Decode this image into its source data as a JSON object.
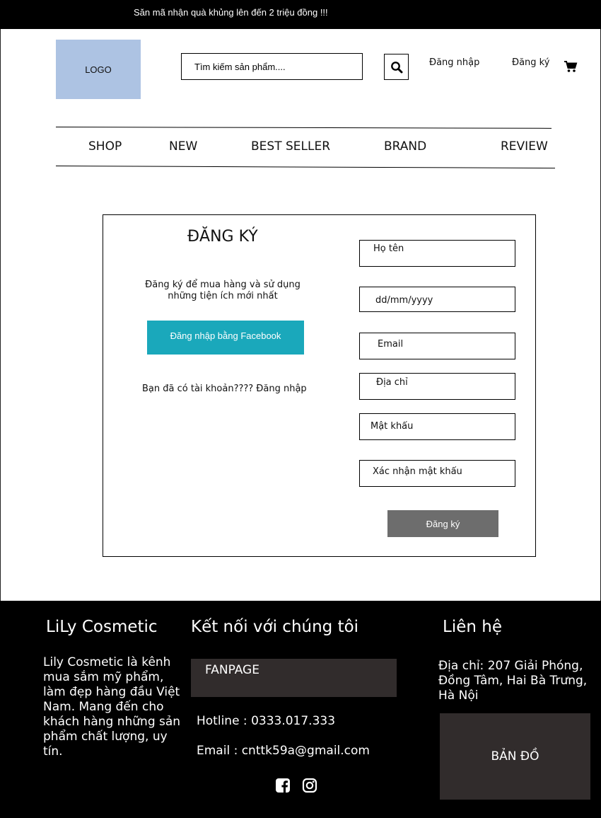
{
  "promo": {
    "text": "Săn mã nhận quà khủng lên đến 2 triệu đồng !!!"
  },
  "header": {
    "logo": "LOGO",
    "search_placeholder": "Tìm kiếm sản phẩm....",
    "login": "Đăng nhập",
    "register": "Đăng ký"
  },
  "nav": {
    "items": [
      "SHOP",
      "NEW",
      "BEST SELLER",
      "BRAND",
      "REVIEW"
    ]
  },
  "register": {
    "title": "ĐĂNG KÝ",
    "description": "Đăng ký để mua hàng và sử dụng những tiện ích mới nhất",
    "facebook_button": "Đăng nhập bằng Facebook",
    "have_account": "Bạn đã có tài khoản???? Đăng nhập",
    "fields": {
      "fullname": "Họ tên",
      "birthday": "dd/mm/yyyy",
      "email": "Email",
      "address": "Địa chỉ",
      "password": "Mật khẩu",
      "confirm_password": "Xác nhận mật khẩu"
    },
    "submit": "Đăng ký"
  },
  "footer": {
    "brand_title": "LiLy Cosmetic",
    "brand_desc": "Lily Cosmetic là kênh mua sắm mỹ phẩm, làm đẹp hàng đầu Việt Nam. Mang đến cho khách hàng những sản phẩm chất lượng, uy tín.",
    "connect_title": "Kết nối với chúng tôi",
    "fanpage": "FANPAGE",
    "hotline": "Hotline : 0333.017.333",
    "email": "Email : cnttk59a@gmail.com",
    "contact_title": "Liên hệ",
    "address": "Địa chỉ: 207 Giải Phóng, Đồng Tâm, Hai Bà Trưng, Hà Nội",
    "map": "BẢN ĐỒ"
  },
  "icons": {
    "search": "search-icon",
    "cart": "cart-icon",
    "facebook": "facebook-icon",
    "instagram": "instagram-icon"
  },
  "colors": {
    "facebook_button": "#1aa8bb",
    "submit_button": "#6d6d6d",
    "logo_bg": "#adc3e3",
    "footer_box": "#312c2c"
  }
}
